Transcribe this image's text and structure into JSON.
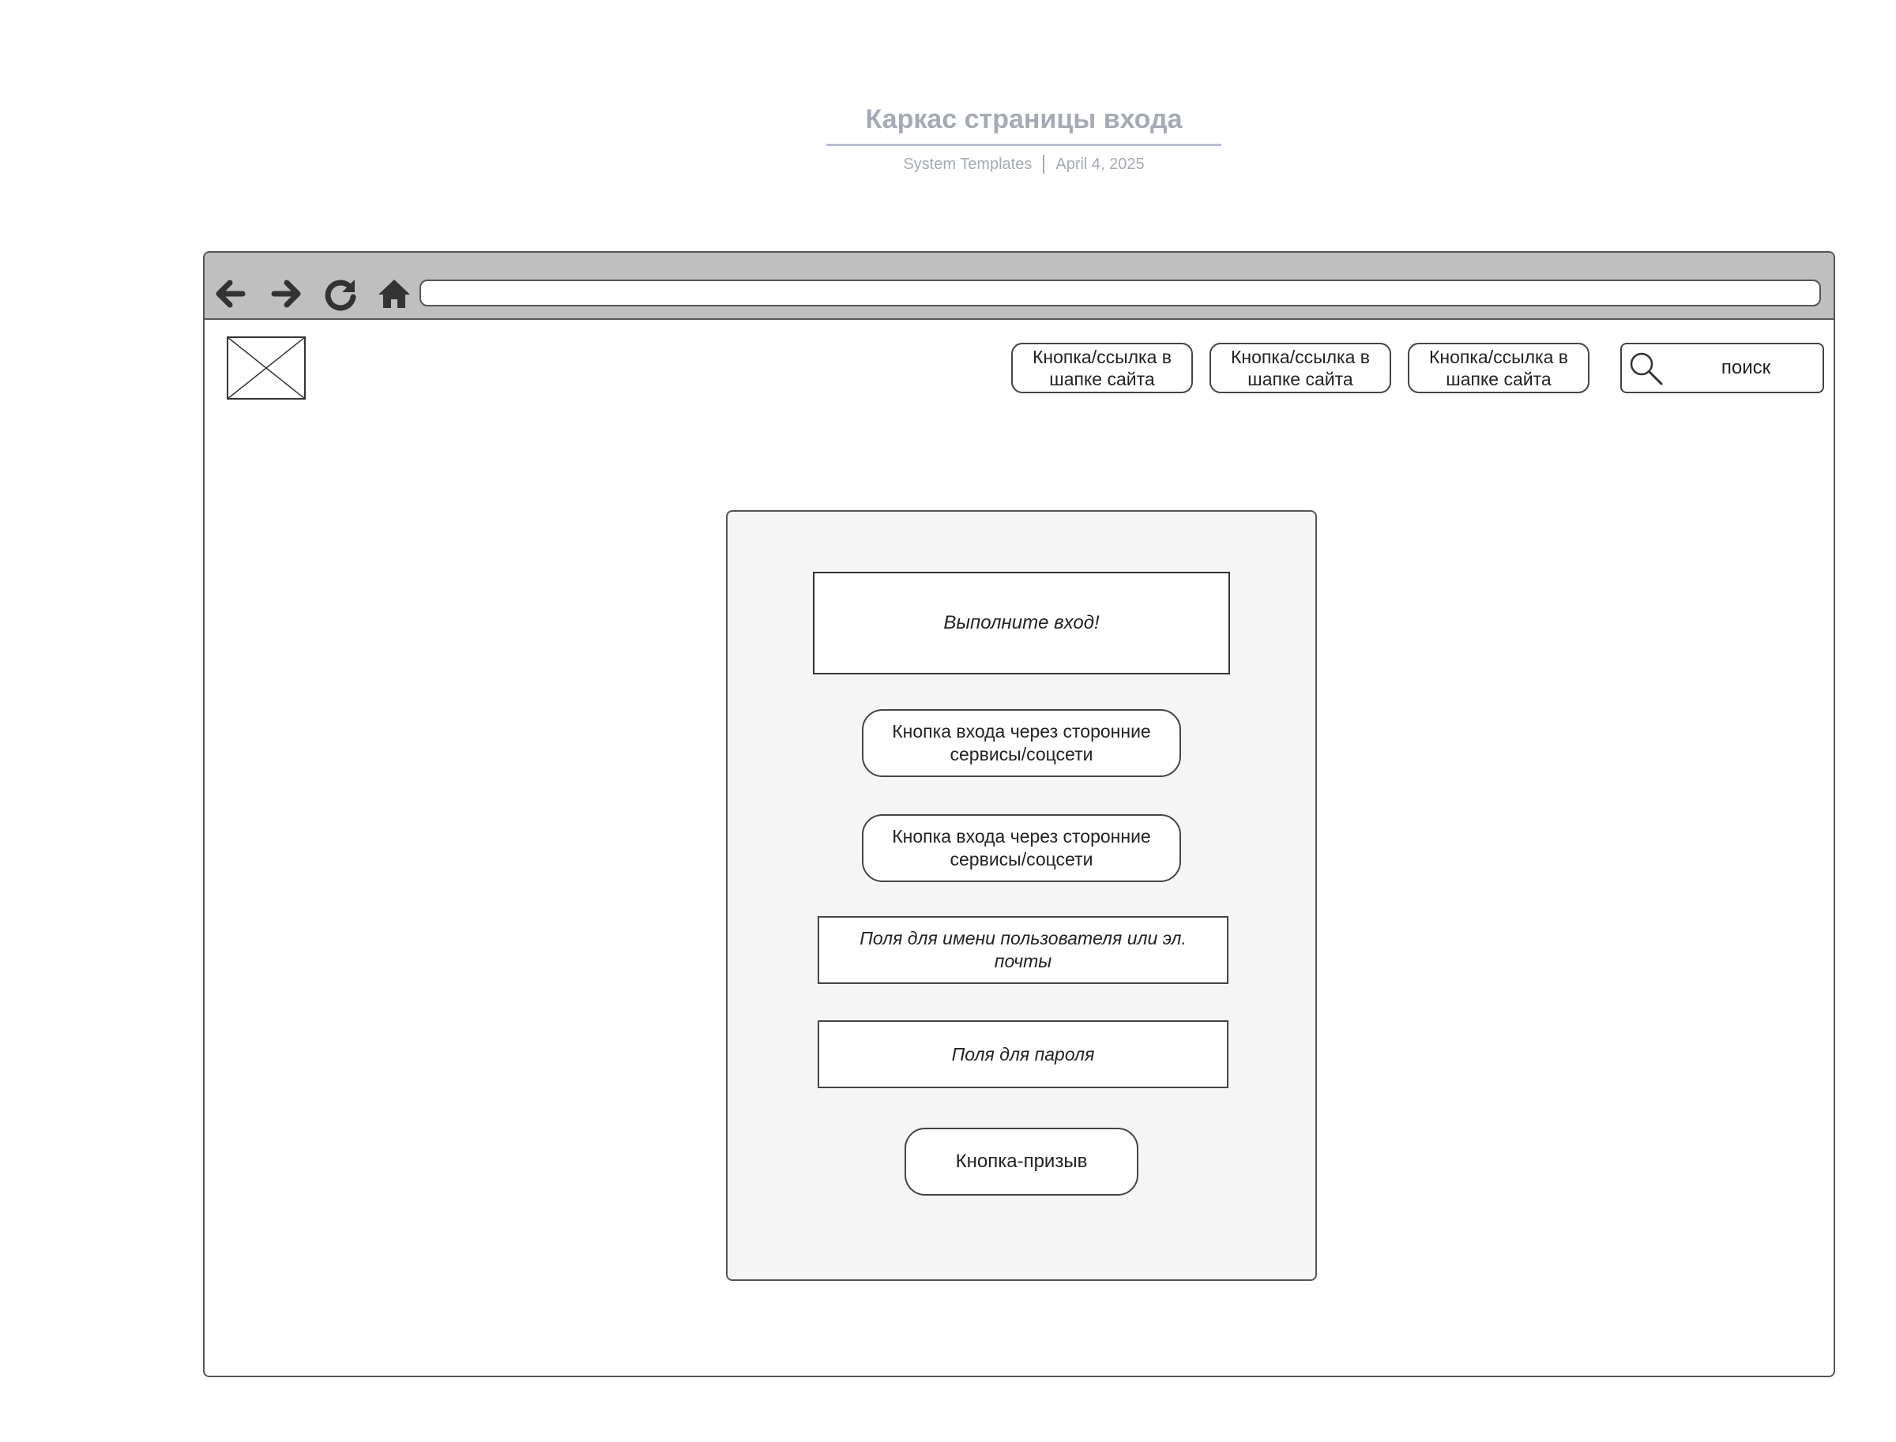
{
  "document": {
    "title": "Каркас страницы входа",
    "source": "System Templates",
    "date": "April 4, 2025"
  },
  "browser": {
    "nav_icons": [
      "back-arrow-icon",
      "forward-arrow-icon",
      "reload-icon",
      "home-icon"
    ],
    "address_value": ""
  },
  "site_header": {
    "logo": "image-placeholder-icon",
    "links": [
      {
        "label": "Кнопка/ссылка в шапке сайта"
      },
      {
        "label": "Кнопка/ссылка в шапке сайта"
      },
      {
        "label": "Кнопка/ссылка в шапке сайта"
      }
    ],
    "search": {
      "icon": "search-icon",
      "label": "поиск"
    }
  },
  "login_form": {
    "welcome": "Выполните вход!",
    "social_buttons": [
      {
        "label": "Кнопка входа через сторонние сервисы/соцсети"
      },
      {
        "label": "Кнопка входа через сторонние сервисы/соцсети"
      }
    ],
    "username_field": "Поля для имени пользователя или эл. почты",
    "password_field": "Поля для пароля",
    "cta_label": "Кнопка-призыв"
  },
  "colors": {
    "toolbar": "#bfbfbf",
    "card": "#f5f5f5",
    "title": "#a5aab4",
    "outline": "#444444"
  }
}
